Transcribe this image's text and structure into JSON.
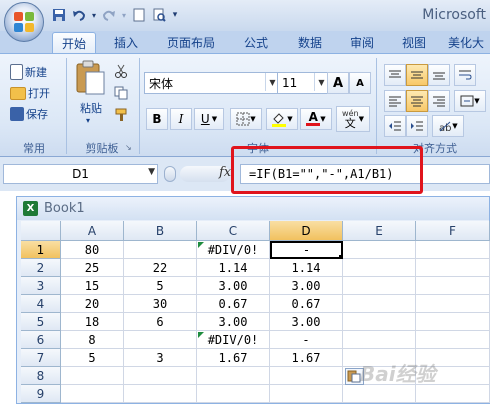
{
  "window": {
    "title": "Microsoft"
  },
  "quick_access": {
    "icons": [
      "save-icon",
      "undo-icon",
      "redo-icon",
      "new-icon",
      "print-preview-icon",
      "customize-icon"
    ]
  },
  "tabs": [
    {
      "label": "开始",
      "active": true
    },
    {
      "label": "插入"
    },
    {
      "label": "页面布局"
    },
    {
      "label": "公式"
    },
    {
      "label": "数据"
    },
    {
      "label": "审阅"
    },
    {
      "label": "视图"
    },
    {
      "label": "美化大"
    }
  ],
  "ribbon": {
    "common": {
      "new": "新建",
      "open": "打开",
      "save": "保存",
      "label": "常用"
    },
    "clipboard": {
      "paste": "粘贴",
      "label": "剪贴板"
    },
    "font": {
      "name": "宋体",
      "size": "11",
      "bold": "B",
      "italic": "I",
      "underline": "U",
      "label": "字体",
      "wen": "wén",
      "wen_char": "文",
      "grow": "A",
      "shrink": "A",
      "font_color_letter": "A"
    },
    "alignment": {
      "label": "对齐方式"
    }
  },
  "formula_bar": {
    "name_box": "D1",
    "fx": "fx",
    "formula": "=IF(B1=\"\",\"-\",A1/B1)"
  },
  "workbook": {
    "title": "Book1",
    "columns": [
      "A",
      "B",
      "C",
      "D",
      "E",
      "F"
    ],
    "rows": [
      {
        "num": "1",
        "cells": [
          "80",
          "",
          "#DIV/0!",
          "-",
          "",
          ""
        ]
      },
      {
        "num": "2",
        "cells": [
          "25",
          "22",
          "1.14",
          "1.14",
          "",
          ""
        ]
      },
      {
        "num": "3",
        "cells": [
          "15",
          "5",
          "3.00",
          "3.00",
          "",
          ""
        ]
      },
      {
        "num": "4",
        "cells": [
          "20",
          "30",
          "0.67",
          "0.67",
          "",
          ""
        ]
      },
      {
        "num": "5",
        "cells": [
          "18",
          "6",
          "3.00",
          "3.00",
          "",
          ""
        ]
      },
      {
        "num": "6",
        "cells": [
          "8",
          "",
          "#DIV/0!",
          "-",
          "",
          ""
        ]
      },
      {
        "num": "7",
        "cells": [
          "5",
          "3",
          "1.67",
          "1.67",
          "",
          ""
        ]
      },
      {
        "num": "8",
        "cells": [
          "",
          "",
          "",
          "",
          "",
          ""
        ]
      },
      {
        "num": "9",
        "cells": [
          "",
          "",
          "",
          "",
          "",
          ""
        ]
      }
    ],
    "selected_cell": "D1"
  },
  "colors": {
    "accent": "#15428b",
    "highlight_box": "#e0141c",
    "error_indicator": "#1f8c3f"
  }
}
